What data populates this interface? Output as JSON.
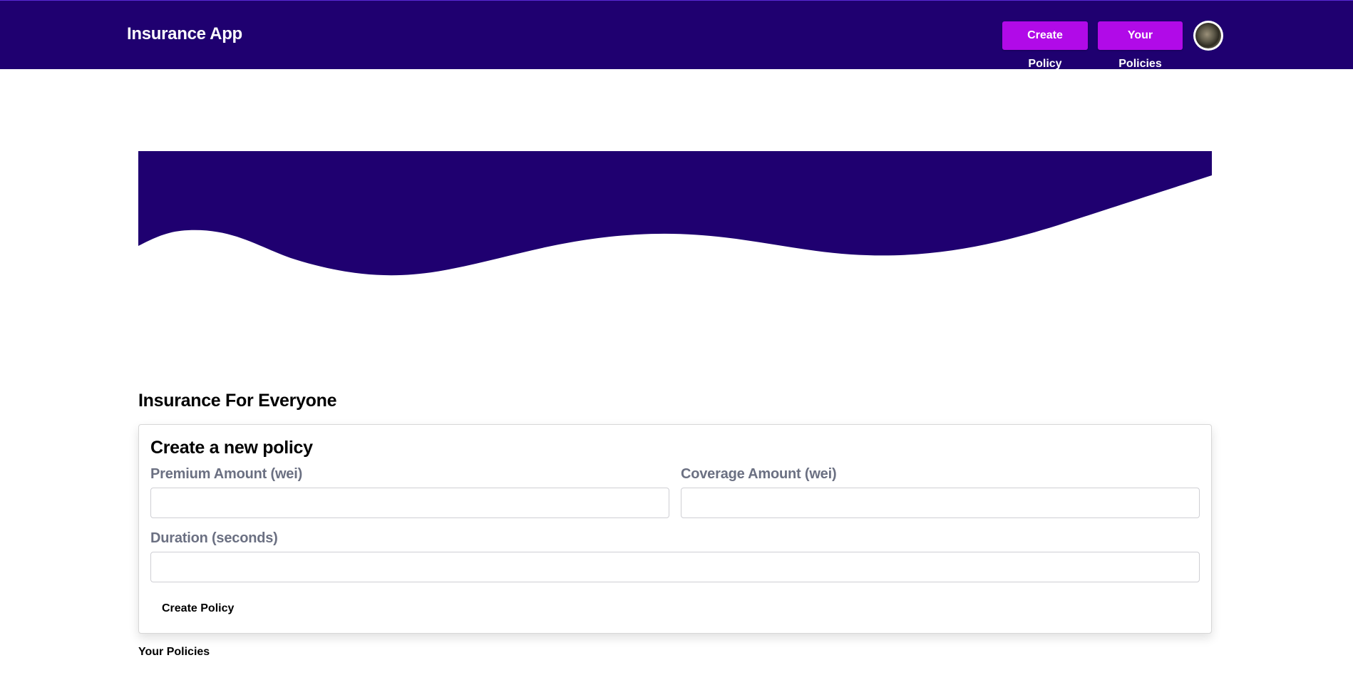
{
  "app": {
    "title": "Insurance App"
  },
  "header": {
    "nav": {
      "create_policy_label": "Create Policy",
      "your_policies_label": "Your Policies"
    },
    "avatar_icon": "user-avatar-icon"
  },
  "colors": {
    "brand": "#1f0070",
    "accent": "#b10ae8",
    "label_gray": "#6b7082"
  },
  "main": {
    "section_title": "Insurance For Everyone",
    "form": {
      "title": "Create a new policy",
      "premium": {
        "label": "Premium Amount (wei)",
        "value": "",
        "placeholder": ""
      },
      "coverage": {
        "label": "Coverage Amount (wei)",
        "value": "",
        "placeholder": ""
      },
      "duration": {
        "label": "Duration (seconds)",
        "value": "",
        "placeholder": ""
      },
      "submit_label": "Create Policy"
    },
    "policies_heading": "Your Policies"
  }
}
